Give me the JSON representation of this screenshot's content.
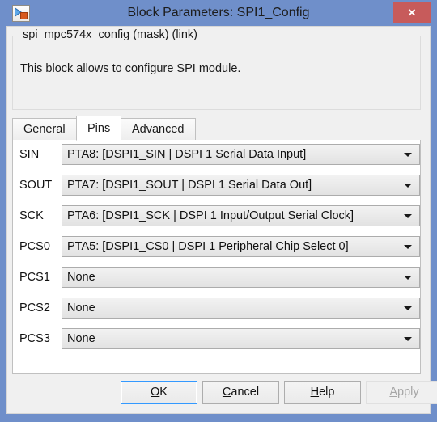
{
  "window": {
    "title": "Block Parameters: SPI1_Config",
    "icon": "simulink-block-icon",
    "close_label": "✕",
    "accent_titlebar": "#6f8fca",
    "accent_close": "#c75b5b",
    "accent_default_button": "#3399ff"
  },
  "description": {
    "legend": "spi_mpc574x_config (mask) (link)",
    "body": "This block allows to configure SPI module."
  },
  "tabs": [
    {
      "label": "General",
      "selected": false
    },
    {
      "label": "Pins",
      "selected": true
    },
    {
      "label": "Advanced",
      "selected": false
    }
  ],
  "pins": [
    {
      "label": "SIN",
      "value": "PTA8: [DSPI1_SIN | DSPI 1 Serial Data Input]"
    },
    {
      "label": "SOUT",
      "value": "PTA7: [DSPI1_SOUT | DSPI 1 Serial Data Out]"
    },
    {
      "label": "SCK",
      "value": "PTA6: [DSPI1_SCK | DSPI 1 Input/Output Serial Clock]"
    },
    {
      "label": "PCS0",
      "value": "PTA5: [DSPI1_CS0 | DSPI 1 Peripheral Chip Select 0]"
    },
    {
      "label": "PCS1",
      "value": "None"
    },
    {
      "label": "PCS2",
      "value": "None"
    },
    {
      "label": "PCS3",
      "value": "None"
    }
  ],
  "footer": {
    "ok": {
      "pre": "",
      "mnemonic": "O",
      "post": "K",
      "state": "default"
    },
    "cancel": {
      "pre": "",
      "mnemonic": "C",
      "post": "ancel",
      "state": "normal"
    },
    "help": {
      "pre": "",
      "mnemonic": "H",
      "post": "elp",
      "state": "normal"
    },
    "apply": {
      "pre": "",
      "mnemonic": "A",
      "post": "pply",
      "state": "disabled"
    }
  }
}
